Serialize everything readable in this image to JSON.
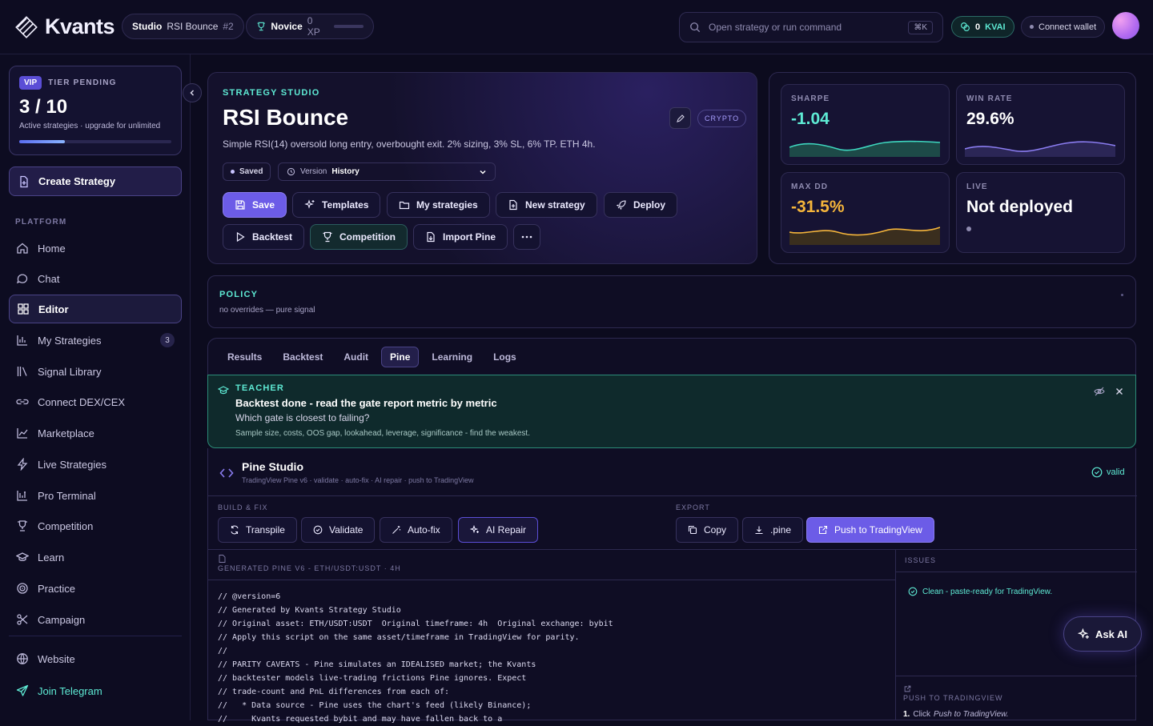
{
  "header": {
    "logo": "Kvants",
    "studio_label": "Studio",
    "studio_name": "RSI Bounce",
    "studio_num": "#2",
    "tier_name": "Novice",
    "xp": "0 XP",
    "search_placeholder": "Open strategy or run command",
    "search_shortcut": "⌘K",
    "kvai_amount": "0",
    "kvai_label": "KVAI",
    "connect_wallet": "Connect wallet"
  },
  "sidebar": {
    "vip_badge": "VIP",
    "tier_status": "TIER PENDING",
    "strategy_count": "3 / 10",
    "strategy_note": "Active strategies · upgrade for unlimited",
    "strategy_usage": 0.3,
    "create_label": "Create Strategy",
    "platform_label": "PLATFORM",
    "items": [
      {
        "label": "Home",
        "icon": "home-icon"
      },
      {
        "label": "Chat",
        "icon": "chat-icon"
      },
      {
        "label": "Editor",
        "icon": "grid-icon",
        "active": true
      },
      {
        "label": "My Strategies",
        "icon": "bar-chart-icon",
        "count": "3"
      },
      {
        "label": "Signal Library",
        "icon": "library-icon"
      },
      {
        "label": "Connect DEX/CEX",
        "icon": "link-icon"
      },
      {
        "label": "Marketplace",
        "icon": "trend-icon"
      },
      {
        "label": "Live Strategies",
        "icon": "bolt-icon"
      },
      {
        "label": "Pro Terminal",
        "icon": "terminal-icon"
      },
      {
        "label": "Competition",
        "icon": "trophy-icon"
      },
      {
        "label": "Learn",
        "icon": "graduation-icon"
      },
      {
        "label": "Practice",
        "icon": "target-icon"
      },
      {
        "label": "Campaign",
        "icon": "scissors-icon"
      }
    ],
    "website": "Website",
    "telegram": "Join Telegram"
  },
  "hero": {
    "eyebrow": "STRATEGY STUDIO",
    "title": "RSI Bounce",
    "description": "Simple RSI(14) oversold long entry, overbought exit. 2% sizing, 3% SL, 6% TP. ETH 4h.",
    "market_tag": "CRYPTO",
    "saved": "Saved",
    "version_label": "Version",
    "version_value": "History",
    "buttons": {
      "save": "Save",
      "templates": "Templates",
      "my_strategies": "My strategies",
      "new_strategy": "New strategy",
      "deploy": "Deploy",
      "backtest": "Backtest",
      "competition": "Competition",
      "import_pine": "Import Pine"
    }
  },
  "metrics": {
    "sharpe_label": "SHARPE",
    "sharpe": "-1.04",
    "winrate_label": "WIN RATE",
    "winrate": "29.6%",
    "maxdd_label": "MAX DD",
    "maxdd": "-31.5%",
    "live_label": "LIVE",
    "live": "Not deployed"
  },
  "policy": {
    "title": "POLICY",
    "text": "no overrides — pure signal"
  },
  "tabs": [
    "Results",
    "Backtest",
    "Audit",
    "Pine",
    "Learning",
    "Logs"
  ],
  "teacher": {
    "label": "TEACHER",
    "title": "Backtest done - read the gate report metric by metric",
    "question": "Which gate is closest to failing?",
    "hint": "Sample size, costs, OOS gap, lookahead, leverage, significance - find the weakest."
  },
  "pine": {
    "title": "Pine Studio",
    "subtitle": "TradingView Pine v6 · validate · auto-fix · AI repair · push to TradingView",
    "status": "valid",
    "build_label": "BUILD & FIX",
    "export_label": "EXPORT",
    "transpile": "Transpile",
    "validate": "Validate",
    "autofix": "Auto-fix",
    "ai_repair": "AI Repair",
    "copy": "Copy",
    "pine_ext": ".pine",
    "push": "Push to TradingView",
    "code_header": "GENERATED PINE V6 - ETH/USDT:USDT · 4H",
    "code_lines": [
      "// @version=6",
      "// Generated by Kvants Strategy Studio",
      "// Original asset: ETH/USDT:USDT  Original timeframe: 4h  Original exchange: bybit",
      "// Apply this script on the same asset/timeframe in TradingView for parity.",
      "//",
      "// PARITY CAVEATS - Pine simulates an IDEALISED market; the Kvants",
      "// backtester models live-trading frictions Pine ignores. Expect",
      "// trade-count and PnL differences from each of:",
      "//   * Data source - Pine uses the chart's feed (likely Binance);",
      "//     Kvants requested bybit and may have fallen back to a"
    ],
    "issues_label": "ISSUES",
    "issues_clean": "Clean - paste-ready for TradingView.",
    "push_label": "PUSH TO TRADINGVIEW",
    "push_step_num": "1.",
    "push_step_text": "Click",
    "push_step_em": "Push to TradingView."
  },
  "ask_ai": "Ask AI"
}
